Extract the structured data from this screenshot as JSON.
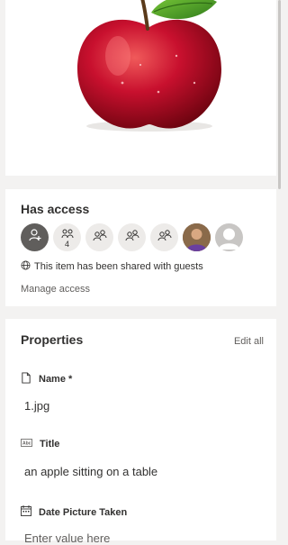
{
  "access": {
    "title": "Has access",
    "group_count": "4",
    "guest_notice": "This item has been shared with guests",
    "manage_link": "Manage access"
  },
  "properties": {
    "title": "Properties",
    "edit_all": "Edit all",
    "fields": [
      {
        "label": "Name *",
        "value": "1.jpg",
        "icon": "document-icon"
      },
      {
        "label": "Title",
        "value": "an apple sitting on a table",
        "icon": "text-field-icon"
      },
      {
        "label": "Date Picture Taken",
        "placeholder": "Enter value here",
        "icon": "calendar-icon"
      }
    ]
  },
  "colors": {
    "panel_bg": "#ffffff",
    "page_bg": "#f3f2f1",
    "avatar_bg": "#edebe9",
    "avatar_dark": "#605e5c",
    "text": "#323130",
    "secondary_text": "#605e5c"
  }
}
